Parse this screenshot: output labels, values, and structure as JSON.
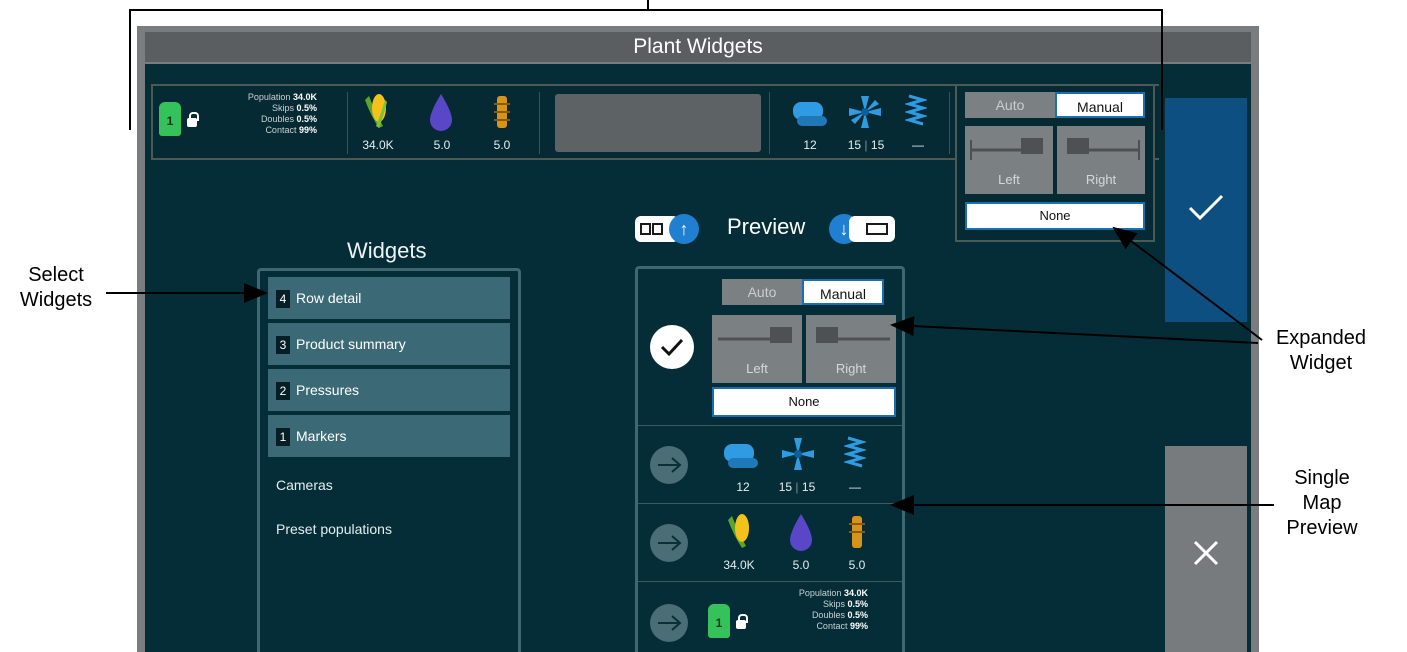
{
  "callouts": {
    "select_widgets": "Select\nWidgets",
    "expanded_widget": "Expanded\nWidget",
    "single_map_preview": "Single\nMap\nPreview"
  },
  "window": {
    "title": "Plant Widgets"
  },
  "row_summary": {
    "row_number": "1",
    "population_label": "Population",
    "population_value": "34.0K",
    "skips_label": "Skips",
    "skips_value": "0.5%",
    "doubles_label": "Doubles",
    "doubles_value": "0.5%",
    "contact_label": "Contact",
    "contact_value": "99%"
  },
  "product_summary": {
    "seed_value": "34.0K",
    "liquid_value": "5.0",
    "insecticide_value": "5.0"
  },
  "pressures": {
    "vacuum_value": "12",
    "fan_value": "15",
    "fan_value_2": "15",
    "spring_value": "—"
  },
  "marker_widget": {
    "auto_label": "Auto",
    "manual_label": "Manual",
    "left_label": "Left",
    "right_label": "Right",
    "none_label": "None"
  },
  "widgets_panel": {
    "title": "Widgets",
    "items": [
      {
        "num": "4",
        "label": "Row detail"
      },
      {
        "num": "3",
        "label": "Product summary"
      },
      {
        "num": "2",
        "label": "Pressures"
      },
      {
        "num": "1",
        "label": "Markers"
      }
    ],
    "extra_items": [
      "Cameras",
      "Preset populations"
    ]
  },
  "preview": {
    "title": "Preview"
  },
  "colors": {
    "screen_bg": "#052d37",
    "accent_blue": "#0d4f80",
    "list_item_bg": "#3b6a76",
    "seed_green": "#35c25a"
  }
}
